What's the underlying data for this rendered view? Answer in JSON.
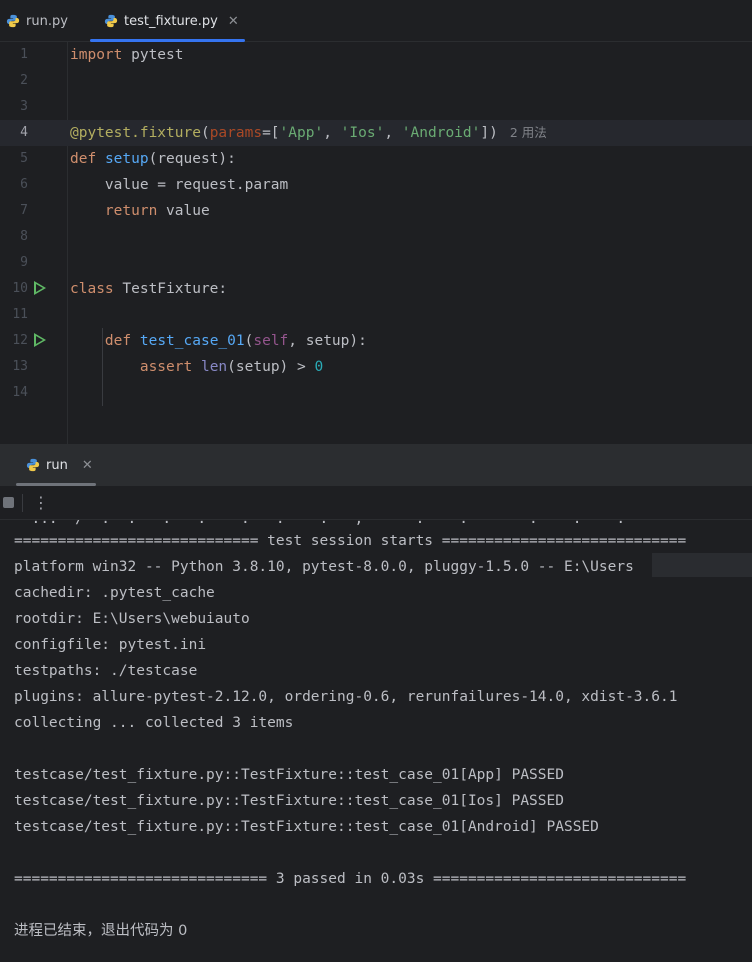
{
  "tabs": [
    {
      "label": "run.py",
      "active": false
    },
    {
      "label": "test_fixture.py",
      "active": true
    }
  ],
  "editor": {
    "lines": [
      "1",
      "2",
      "3",
      "4",
      "5",
      "6",
      "7",
      "8",
      "9",
      "10",
      "11",
      "12",
      "13",
      "14"
    ],
    "code": {
      "l1_kw": "import",
      "l1_rest": " pytest",
      "l4_deco": "@pytest.fixture",
      "l4_open": "(",
      "l4_param": "params",
      "l4_eq": "=[",
      "l4_s1": "'App'",
      "l4_c1": ", ",
      "l4_s2": "'Ios'",
      "l4_c2": ", ",
      "l4_s3": "'Android'",
      "l4_close": "])",
      "l4_hint": "2 用法",
      "l5_kw": "def",
      "l5_fn": "setup",
      "l5_rest": "(request):",
      "l6": "    value = request.param",
      "l7_kw": "return",
      "l7_rest": " value",
      "l10_kw": "class",
      "l10_rest": " TestFixture:",
      "l12_kw": "def",
      "l12_fn": "test_case_01",
      "l12_open": "(",
      "l12_self": "self",
      "l12_rest": ", setup):",
      "l13_kw": "assert",
      "l13_builtin": "len",
      "l13_mid": "(setup) > ",
      "l13_num": "0"
    }
  },
  "run_panel": {
    "tab_label": "run",
    "more_icon": "⋮"
  },
  "console": {
    "cut_line": "  ...  /  .  .   .   .    .   .    .   ,      .    .       .    .    .",
    "lines": [
      "============================ test session starts ============================",
      "platform win32 -- Python 3.8.10, pytest-8.0.0, pluggy-1.5.0 -- E:\\Users",
      "cachedir: .pytest_cache",
      "rootdir: E:\\Users\\webuiauto",
      "configfile: pytest.ini",
      "testpaths: ./testcase",
      "plugins: allure-pytest-2.12.0, ordering-0.6, rerunfailures-14.0, xdist-3.6.1",
      "collecting ... collected 3 items",
      "",
      "testcase/test_fixture.py::TestFixture::test_case_01[App] PASSED",
      "testcase/test_fixture.py::TestFixture::test_case_01[Ios] PASSED",
      "testcase/test_fixture.py::TestFixture::test_case_01[Android] PASSED",
      "",
      "============================= 3 passed in 0.03s =============================",
      "",
      "进程已结束，退出代码为 0"
    ]
  },
  "colors": {
    "background": "#1e1f22",
    "keyword": "#cf8e6d",
    "string": "#6aab73",
    "function": "#56a8f5",
    "accent": "#3574f0",
    "run": "#5fb865"
  }
}
